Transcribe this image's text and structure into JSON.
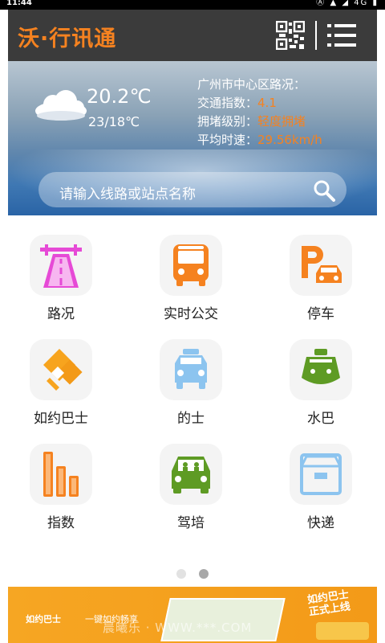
{
  "status_bar": {
    "time": "11:44",
    "right": "Ⓐ ▲ ◢ 4G ▮"
  },
  "header": {
    "title": "沃·行讯通"
  },
  "weather": {
    "temperature": "20.2℃",
    "range": "23/18℃"
  },
  "traffic": {
    "title": "广州市中心区路况：",
    "index_label": "交通指数：",
    "index_value": "4.1",
    "level_label": "拥堵级别：",
    "level_value": "轻度拥堵",
    "speed_label": "平均时速：",
    "speed_value": "29.56km/h"
  },
  "search": {
    "placeholder": "请输入线路或站点名称"
  },
  "grid": {
    "road": "路况",
    "bus": "实时公交",
    "parking": "停车",
    "ruyue": "如约巴士",
    "taxi": "的士",
    "ferry": "水巴",
    "index": "指数",
    "driving": "驾培",
    "express": "快递"
  },
  "pager": {
    "count": 2,
    "active": 2
  },
  "banner": {
    "brand": "如约巴士",
    "tagline": "一键如约畅享",
    "badge_line1": "如约巴士",
    "badge_line2": "正式上线",
    "watermark": "晨曦乐 · WWW.***.COM"
  },
  "colors": {
    "accent": "#f58220",
    "header_bg": "#3b3b3b",
    "icon_magenta": "#e64ad6",
    "icon_blue": "#8cc4ef",
    "icon_green": "#5e9b24"
  }
}
